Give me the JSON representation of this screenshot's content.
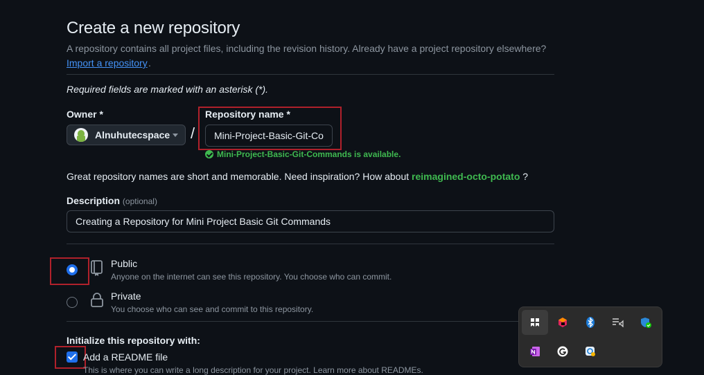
{
  "header": {
    "title": "Create a new repository",
    "subtitle": "A repository contains all project files, including the revision history. Already have a project repository elsewhere?",
    "import_link": "Import a repository",
    "import_suffix": "."
  },
  "form": {
    "required_note": "Required fields are marked with an asterisk (*).",
    "owner_label": "Owner *",
    "owner_value": "Alnuhutecspace",
    "separator": "/",
    "repo_label": "Repository name *",
    "repo_value": "Mini-Project-Basic-Git-Co",
    "availability": "Mini-Project-Basic-Git-Commands is available.",
    "hint_prefix": "Great repository names are short and memorable. Need inspiration? How about",
    "hint_suggestion": "reimagined-octo-potato",
    "hint_suffix": "?",
    "description_label": "Description",
    "description_optional": "(optional)",
    "description_value": "Creating a Repository for Mini Project Basic Git Commands"
  },
  "visibility": {
    "selected": "public",
    "public_title": "Public",
    "public_desc": "Anyone on the internet can see this repository. You choose who can commit.",
    "private_title": "Private",
    "private_desc": "You choose who can see and commit to this repository."
  },
  "init": {
    "title": "Initialize this repository with:",
    "readme_label": "Add a README file",
    "readme_checked": true,
    "readme_desc": "This is where you can write a long description for your project. Learn more about READMEs."
  },
  "tray": {
    "icons": [
      "pinned-app-icon",
      "jetbrains-toolbox-icon",
      "bluetooth-icon",
      "media-control-icon",
      "windows-security-icon",
      "onenote-icon",
      "grammarly-icon",
      "teams-chat-icon"
    ]
  },
  "colors": {
    "background": "#0d1117",
    "accent": "#1f6feb",
    "link": "#4493f8",
    "success": "#3fb950",
    "annotation_red": "#b0212b"
  }
}
